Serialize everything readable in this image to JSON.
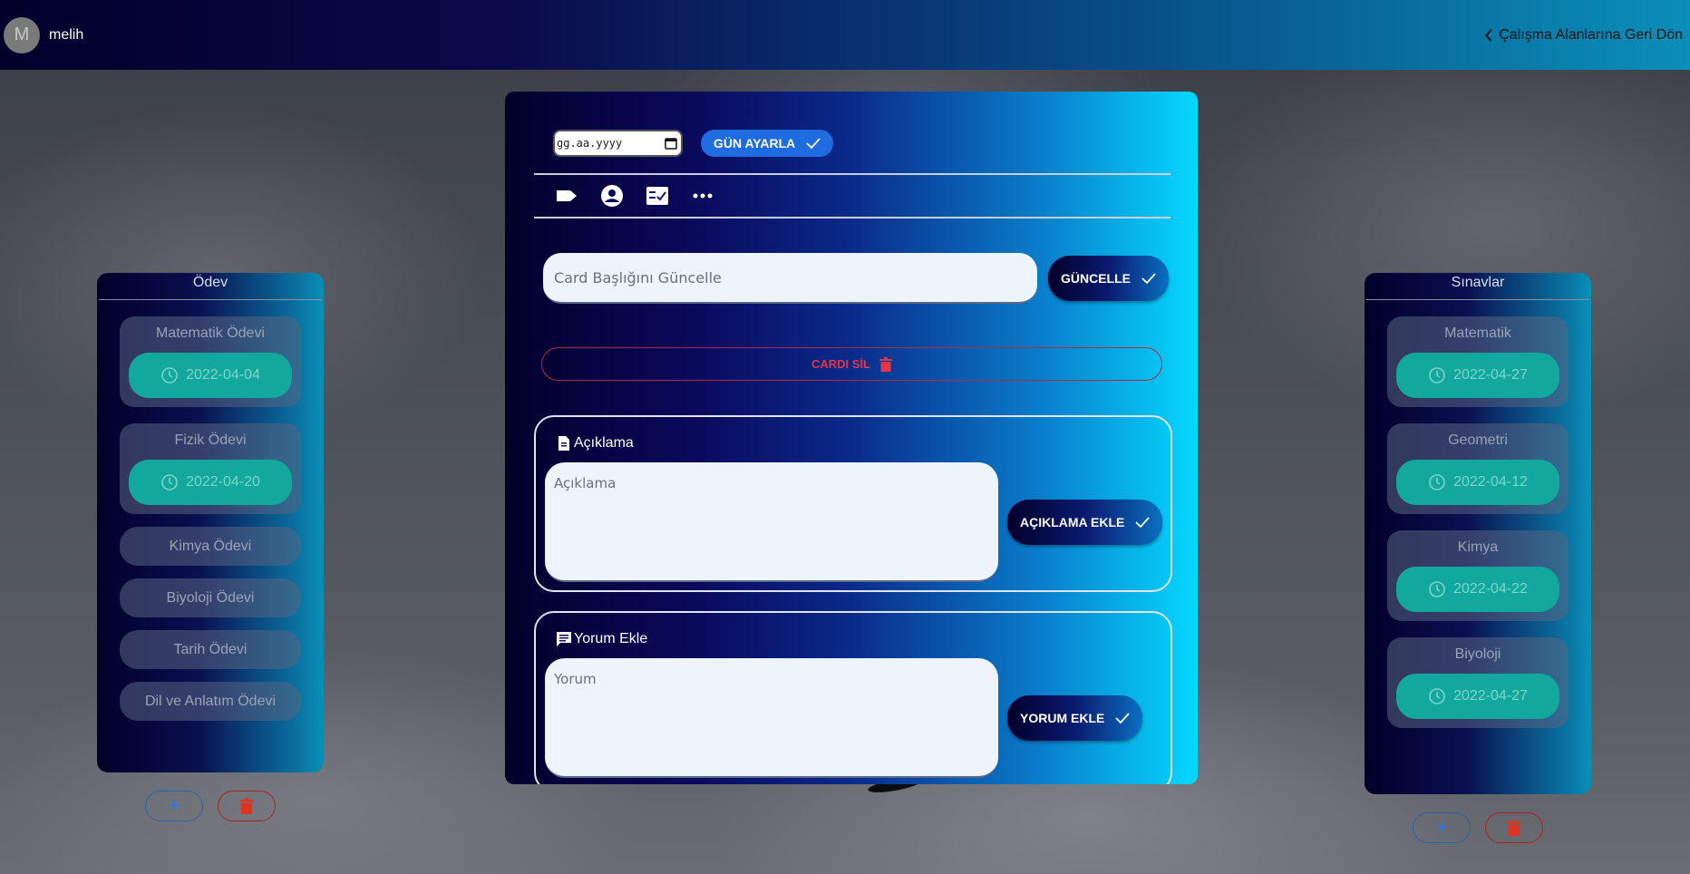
{
  "topbar": {
    "avatar_letter": "M",
    "username": "melih",
    "back_label": "Çalışma Alanlarına Geri Dön"
  },
  "left_column": {
    "title": "Ödev",
    "cards": [
      {
        "title": "Matematik Ödevi",
        "date": "2022-04-04"
      },
      {
        "title": "Fizik Ödevi",
        "date": "2022-04-20"
      }
    ],
    "items": [
      "Kimya Ödevi",
      "Biyoloji Ödevi",
      "Tarih Ödevi",
      "Dil ve Anlatım Ödevi"
    ]
  },
  "right_column": {
    "title": "Sınavlar",
    "cards": [
      {
        "title": "Matematik",
        "date": "2022-04-27"
      },
      {
        "title": "Geometri",
        "date": "2022-04-12"
      },
      {
        "title": "Kimya",
        "date": "2022-04-22"
      },
      {
        "title": "Biyoloji",
        "date": "2022-04-27"
      }
    ]
  },
  "modal": {
    "date_placeholder": "gg.aa.yyyy",
    "set_day_label": "GÜN AYARLA",
    "title_placeholder": "Card Başlığını Güncelle",
    "update_label": "GÜNCELLE",
    "delete_label": "CARDI SİL",
    "description": {
      "heading": "Açıklama",
      "placeholder": "Açıklama",
      "button_label": "AÇIKLAMA EKLE"
    },
    "comment": {
      "heading": "Yorum Ekle",
      "placeholder": "Yorum",
      "button_label": "YORUM EKLE"
    }
  },
  "colors": {
    "accent_teal": "#13a89e",
    "primary_blue": "#1f6ce0",
    "danger_red": "#e2374a"
  }
}
